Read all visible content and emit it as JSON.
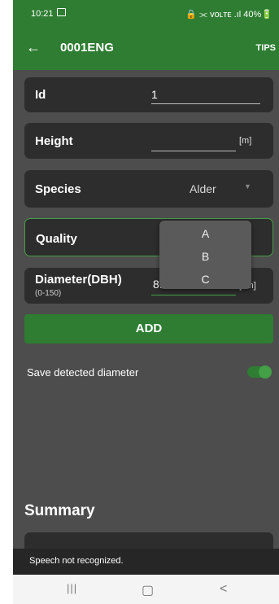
{
  "status_bar": {
    "time": "10:21",
    "right_text": "🔒 ⫘ ᴠᴏʟᴛᴇ .ıl 40%🔋"
  },
  "app_bar": {
    "back_icon": "arrow-left-icon",
    "title": "0001ENG",
    "tips_label": "TIPS"
  },
  "form": {
    "id": {
      "label": "Id",
      "value": "1"
    },
    "height": {
      "label": "Height",
      "value": "",
      "unit": "[m]"
    },
    "species": {
      "label": "Species",
      "value": "Alder"
    },
    "quality": {
      "label": "Quality",
      "options": [
        "A",
        "B",
        "C"
      ]
    },
    "diameter": {
      "label": "Diameter(DBH)",
      "range": "(0-150)",
      "value": "8.",
      "unit": "[cm]"
    }
  },
  "add_button": {
    "label": "ADD"
  },
  "save_detected": {
    "label": "Save detected diameter",
    "enabled": true
  },
  "summary": {
    "title": "Summary"
  },
  "toast": {
    "text": "Speech not recognized."
  },
  "nav": {
    "recents": "|||",
    "home": "▢",
    "back": "<"
  },
  "colors": {
    "accent": "#2e7d32",
    "background": "#4d4d4d",
    "card": "#2d2d2d"
  }
}
